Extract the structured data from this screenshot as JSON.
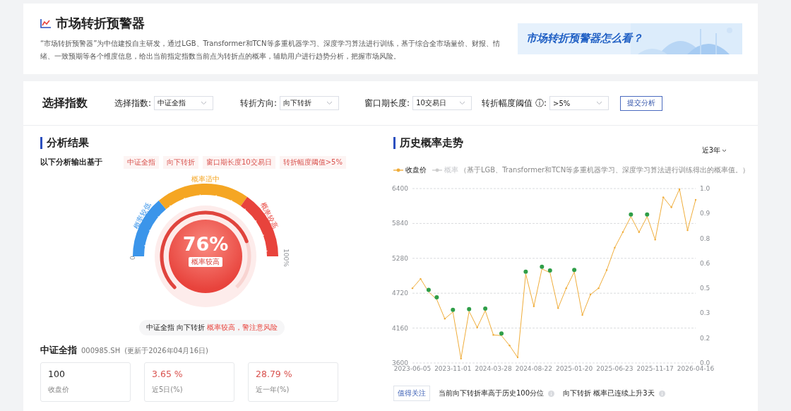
{
  "header": {
    "title": "市场转折预警器",
    "description": "“市场转折预警器”为中信建投自主研发，通过LGB、Transformer和TCN等多重机器学习、深度学习算法进行训练，基于综合全市场量价、财报、情绪、一致预期等各个维度信息，给出当前指定指数当前点为转折点的概率，辅助用户进行趋势分析，把握市场风险。",
    "banner": {
      "text": "市场转折预警器怎么看？"
    }
  },
  "selector": {
    "title": "选择指数",
    "fields": [
      {
        "label": "选择指数:",
        "value": "中证全指"
      },
      {
        "label": "转折方向:",
        "value": "向下转折"
      },
      {
        "label": "窗口期长度:",
        "value": "10交易日"
      },
      {
        "label": "转折幅度阈值 ⓘ:",
        "value": ">5%"
      }
    ],
    "submit": "提交分析"
  },
  "analysis": {
    "title": "分析结果",
    "basis_label": "以下分析输出基于",
    "tags": [
      "中证全指",
      "向下转折",
      "窗口期长度10交易日",
      "转折幅度阈值>5%"
    ],
    "gauge": {
      "zones": [
        {
          "label": "概率较低",
          "color": "#3b95ea"
        },
        {
          "label": "概率适中",
          "color": "#f5a623"
        },
        {
          "label": "概率较高",
          "color": "#e8433c"
        }
      ],
      "min_label": "0",
      "max_label": "100%",
      "value": "76%",
      "verdict": "概率较高"
    },
    "summary": {
      "text": "中证全指 向下转折",
      "alert": "概率较高，警注意风险"
    },
    "index": {
      "name": "中证全指",
      "code": "000985.SH",
      "updated": "(更新于2026年04月16日)"
    },
    "stats": [
      {
        "value": "100",
        "label": "收盘价",
        "color": "#222222"
      },
      {
        "value": "3.65 %",
        "label": "近5日(%)",
        "color": "#d9534f"
      },
      {
        "value": "28.79 %",
        "label": "近一年(%)",
        "color": "#d9534f"
      }
    ]
  },
  "history": {
    "title": "历史概率走势",
    "range": "近3年",
    "legend": [
      {
        "label": "概率",
        "on": false
      }
    ],
    "legend_note": "（基于LGB、Transformer和TCN等多重机器学习、深度学习算法进行训练得出的概率值。）",
    "chart_data": {
      "type": "line",
      "grid": true,
      "ylim": [
        3600,
        6400
      ],
      "yticks": [
        3600,
        4160,
        4720,
        5280,
        5840,
        6400
      ],
      "categories": [
        "2023-06-05",
        null,
        null,
        null,
        null,
        "2023-11-01",
        null,
        null,
        null,
        null,
        "2024-03-28",
        null,
        null,
        null,
        null,
        "2024-08-22",
        null,
        null,
        null,
        null,
        "2025-01-20",
        null,
        null,
        null,
        null,
        "2025-06-23",
        null,
        null,
        null,
        null,
        "2025-11-17",
        null,
        null,
        null,
        null,
        "2026-04-16"
      ],
      "series": [
        {
          "name": "收盘价",
          "color": "#f0ad3a",
          "values": [
            4800,
            4950,
            4740,
            4620,
            4310,
            4420,
            3670,
            4430,
            4170,
            4440,
            4050,
            4040,
            3880,
            3690,
            5030,
            4510,
            5110,
            5050,
            4480,
            4800,
            5060,
            4370,
            4700,
            4800,
            5090,
            5450,
            5700,
            5950,
            5700,
            5950,
            5580,
            6260,
            6100,
            6390,
            5730,
            6220
          ]
        }
      ]
    },
    "signal_marks": [
      false,
      false,
      true,
      true,
      false,
      true,
      false,
      true,
      false,
      true,
      false,
      true,
      false,
      false,
      true,
      false,
      true,
      true,
      false,
      false,
      true,
      false,
      false,
      false,
      false,
      false,
      false,
      true,
      false,
      true,
      false,
      false,
      false,
      false,
      false,
      false
    ],
    "right_axis_ticks": [
      "1.0",
      "0.9",
      "0.8",
      "0.6",
      "0.5",
      "0.3",
      "0.2",
      "0.0"
    ],
    "notes": {
      "tag": "值得关注",
      "items": [
        "当前向下转折率高于历史100分位",
        "向下转折 概率已连续上升3天"
      ]
    }
  }
}
